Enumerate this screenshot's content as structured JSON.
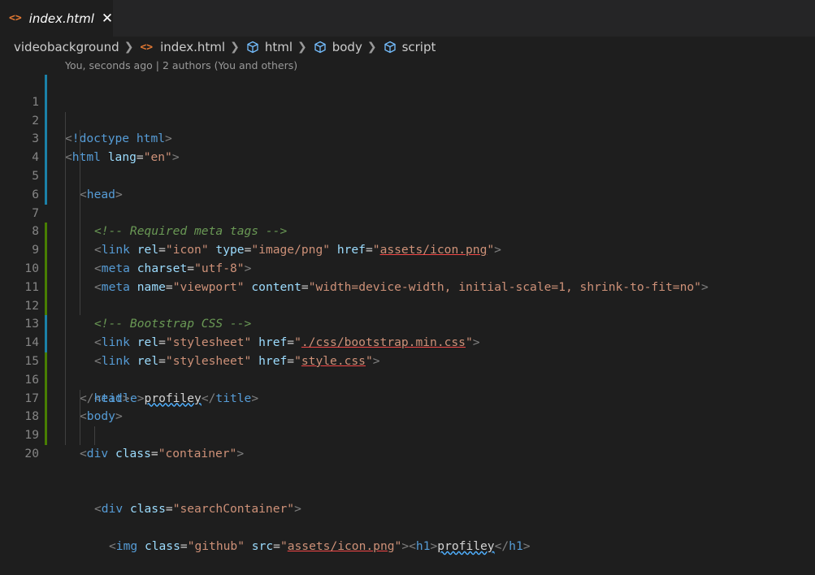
{
  "tab": {
    "icon": "html-file-icon",
    "label": "index.html",
    "close_glyph": "✕"
  },
  "breadcrumb": {
    "items": [
      "videobackground",
      "index.html",
      "html",
      "body",
      "script"
    ]
  },
  "codelens": "You, seconds ago | 2 authors (You and others)",
  "line_numbers": [
    "1",
    "2",
    "3",
    "4",
    "5",
    "6",
    "7",
    "8",
    "9",
    "10",
    "11",
    "12",
    "13",
    "14",
    "15",
    "16",
    "17",
    "18",
    "19",
    "20"
  ],
  "code": {
    "l1": [
      "<",
      "!doctype html",
      ">"
    ],
    "l2": [
      "<",
      "html",
      " ",
      "lang",
      "=",
      "\"en\"",
      ">"
    ],
    "l3": [
      "<",
      "head",
      ">"
    ],
    "l4": [
      "<!-- Required meta tags -->"
    ],
    "l5": [
      "<",
      "link",
      " ",
      "rel",
      "=",
      "\"icon\"",
      " ",
      "type",
      "=",
      "\"image/png\"",
      " ",
      "href",
      "=",
      "\"",
      "assets/icon.png",
      "\"",
      ">"
    ],
    "l6": [
      "<",
      "meta",
      " ",
      "charset",
      "=",
      "\"utf-8\"",
      ">"
    ],
    "l7": [
      "<",
      "meta",
      " ",
      "name",
      "=",
      "\"viewport\"",
      " ",
      "content",
      "=",
      "\"width=device-width, initial-scale=1, shrink-to-fit=no\"",
      ">"
    ],
    "l9": [
      "<!-- Bootstrap CSS -->"
    ],
    "l10": [
      "<",
      "link",
      " ",
      "rel",
      "=",
      "\"stylesheet\"",
      " ",
      "href",
      "=",
      "\"",
      "./css/bootstrap.min.css",
      "\"",
      ">"
    ],
    "l11": [
      "<",
      "link",
      " ",
      "rel",
      "=",
      "\"stylesheet\"",
      " ",
      "href",
      "=",
      "\"",
      "style.css",
      "\"",
      ">"
    ],
    "l13": [
      "<",
      "title",
      ">",
      "profiley",
      "</",
      "title",
      ">"
    ],
    "l14": [
      "</",
      "head",
      ">"
    ],
    "l15": [
      "<",
      "body",
      ">"
    ],
    "l17": [
      "<",
      "div",
      " ",
      "class",
      "=",
      "\"container\"",
      ">"
    ],
    "l19": [
      "<",
      "div",
      " ",
      "class",
      "=",
      "\"searchContainer\"",
      ">"
    ],
    "l20": [
      "<",
      "img",
      " ",
      "class",
      "=",
      "\"github\"",
      " ",
      "src",
      "=",
      "\"",
      "assets/icon.png",
      "\"",
      ">",
      "<",
      "h1",
      ">",
      "profiley",
      "</",
      "h1",
      ">"
    ]
  },
  "colors": {
    "background": "#1e1e1e",
    "tag_bracket": "#808080",
    "tag_name": "#569cd6",
    "attribute": "#9cdcfe",
    "string": "#ce9178",
    "comment": "#6a9955",
    "added_line_marker": "#487e02",
    "modified_line_marker": "#1b81a8"
  }
}
